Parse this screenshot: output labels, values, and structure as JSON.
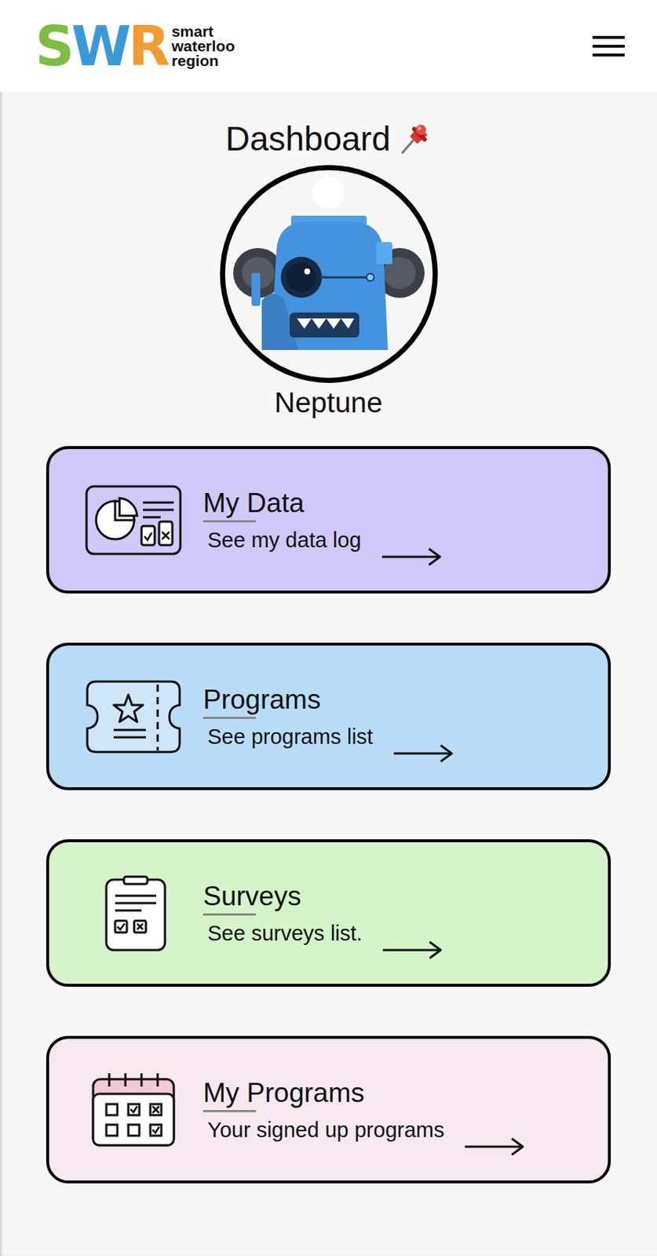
{
  "header": {
    "logo": {
      "letters": [
        {
          "text": "S",
          "color": "#7dbd42"
        },
        {
          "text": "W",
          "color": "#3a9ad9"
        },
        {
          "text": "R",
          "color": "#f39b34"
        }
      ],
      "tagline": [
        "smart",
        "waterloo",
        "region"
      ]
    }
  },
  "dashboard": {
    "title": "Dashboard",
    "user": {
      "name": "Neptune"
    }
  },
  "cards": [
    {
      "title": "My Data",
      "subtitle": "See my data log",
      "color": "#d0c9f9"
    },
    {
      "title": "Programs",
      "subtitle": "See programs list",
      "color": "#b9ddf8"
    },
    {
      "title": "Surveys",
      "subtitle": "See surveys list.",
      "color": "#d5f4c9"
    },
    {
      "title": "My Programs",
      "subtitle": "Your signed up programs",
      "color": "#f8e9f1"
    }
  ]
}
